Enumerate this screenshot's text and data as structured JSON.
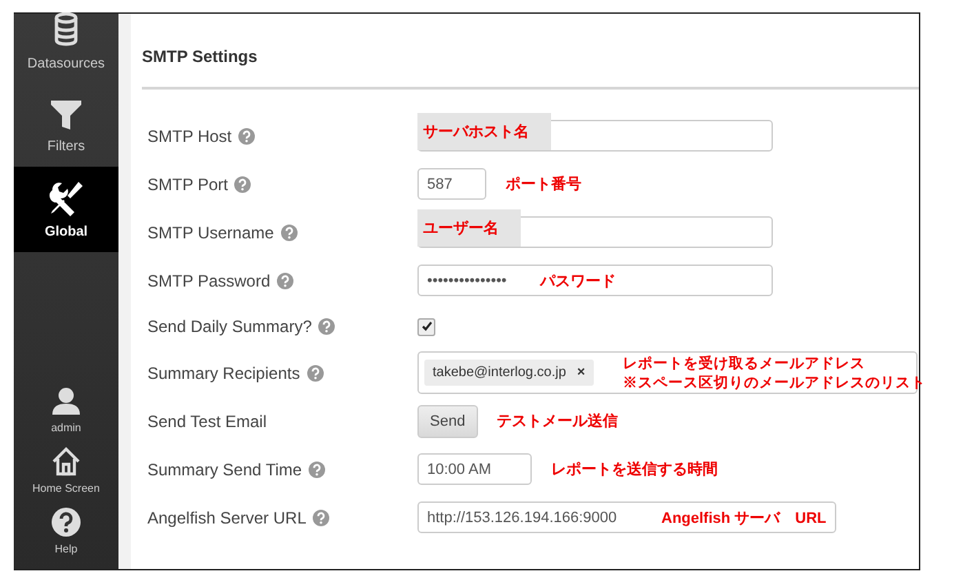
{
  "sidebar": {
    "items": [
      {
        "label": "Datasources",
        "selected": false
      },
      {
        "label": "Filters",
        "selected": false
      },
      {
        "label": "Global",
        "selected": true
      }
    ],
    "footer_items": [
      {
        "label": "admin"
      },
      {
        "label": "Home Screen"
      },
      {
        "label": "Help"
      }
    ]
  },
  "section": {
    "title": "SMTP Settings"
  },
  "rows": [
    {
      "label": "SMTP Host",
      "help": true,
      "kind": "text",
      "notes": [
        {
          "text": "サーバホスト名",
          "kind": "patch"
        }
      ]
    },
    {
      "label": "SMTP Port",
      "help": true,
      "kind": "short",
      "value": "587",
      "notes": [
        {
          "text": "ポート番号",
          "kind": "beside"
        }
      ]
    },
    {
      "label": "SMTP Username",
      "help": true,
      "kind": "text",
      "notes": [
        {
          "text": "ユーザー名",
          "kind": "patch"
        }
      ]
    },
    {
      "label": "SMTP Password",
      "help": true,
      "kind": "password",
      "value": "•••••••••••••••",
      "notes": [
        {
          "text": "パスワード",
          "kind": "inside"
        }
      ]
    },
    {
      "label": "Send Daily Summary?",
      "help": true,
      "kind": "checkbox",
      "checked": true
    },
    {
      "label": "Summary Recipients",
      "help": true,
      "kind": "tags",
      "tags": [
        {
          "text": "takebe@interlog.co.jp",
          "remove": "×"
        }
      ],
      "notes": [
        {
          "text": "レポートを受け取るメールアドレス",
          "kind": "inside"
        },
        {
          "text": "※スペース区切りのメールアドレスのリスト",
          "kind": "inside"
        }
      ]
    },
    {
      "label": "Send Test Email",
      "help": false,
      "kind": "button",
      "button": "Send",
      "notes": [
        {
          "text": "テストメール送信",
          "kind": "beside"
        }
      ]
    },
    {
      "label": "Summary Send Time",
      "help": true,
      "kind": "time",
      "value": "10:00 AM",
      "notes": [
        {
          "text": "レポートを送信する時間",
          "kind": "beside"
        }
      ]
    },
    {
      "label": "Angelfish Server URL",
      "help": true,
      "kind": "url",
      "value": "http://153.126.194.166:9000",
      "notes": [
        {
          "text": "Angelfish サーバ　URL",
          "kind": "inside"
        }
      ]
    }
  ]
}
